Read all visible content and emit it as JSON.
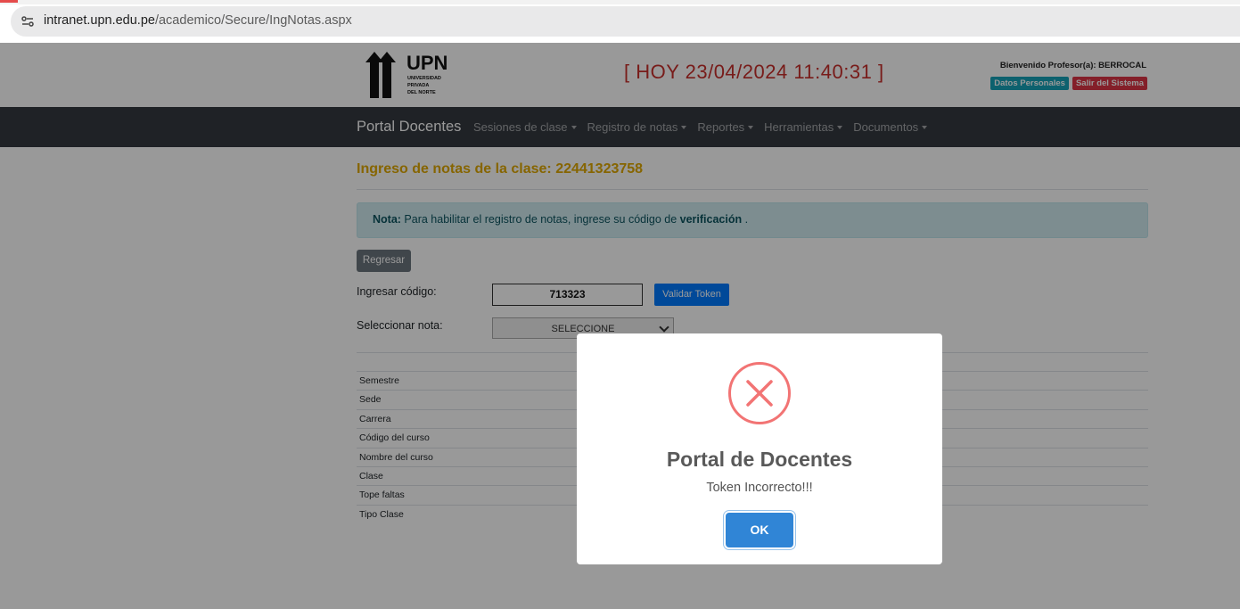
{
  "browser": {
    "url_host": "intranet.upn.edu.pe",
    "url_path": "/academico/Secure/IngNotas.aspx"
  },
  "header": {
    "logo_text": "UPN",
    "logo_subtext": [
      "UNIVERSIDAD",
      "PRIVADA",
      "DEL NORTE"
    ],
    "clock": "[ HOY 23/04/2024 11:40:31 ]",
    "welcome": "Bienvenido Profesor(a): BERROCAL",
    "datos_personales": "Datos Personales",
    "salir": "Salir del Sistema"
  },
  "nav": {
    "brand": "Portal Docentes",
    "items": [
      "Sesiones de clase",
      "Registro de notas",
      "Reportes",
      "Herramientas",
      "Documentos"
    ]
  },
  "main": {
    "title": "Ingreso de notas de la clase: 22441323758",
    "alert_label": "Nota:",
    "alert_text": " Para habilitar el registro de notas, ingrese su código de ",
    "alert_strong": "verificación",
    "alert_end": " .",
    "back_button": "Regresar",
    "code_label": "Ingresar código:",
    "code_value": "713323",
    "validate_button": "Validar Token",
    "select_label": "Seleccionar nota:",
    "select_value": "SELECCIONE",
    "info_rows": [
      "Semestre",
      "Sede",
      "Carrera",
      "Código del curso",
      "Nombre del curso",
      "Clase",
      "Tope faltas",
      "Tipo Clase"
    ]
  },
  "modal": {
    "title": "Portal de Docentes",
    "message": "Token Incorrecto!!!",
    "ok": "OK"
  },
  "colors": {
    "accent": "#3085d6",
    "error": "#f27474",
    "title": "#e0a800",
    "clock": "#c9302c"
  }
}
